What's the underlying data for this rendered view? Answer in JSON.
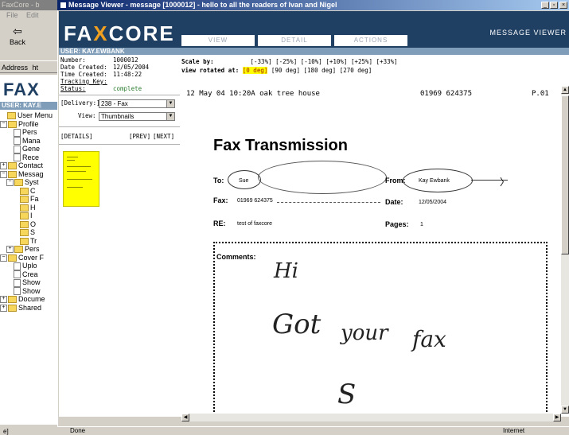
{
  "background_window": {
    "title": "FaxCore - b",
    "menu": [
      "File",
      "Edit"
    ],
    "back_label": "Back",
    "address_label": "Address",
    "address_value": "ht",
    "logo": "FAX",
    "user_label": "USER: KAY.E",
    "tree": [
      {
        "label": "User Menu",
        "icon": "folder-icon",
        "exp": ""
      },
      {
        "label": "Profile",
        "icon": "folder-icon",
        "exp": "−"
      },
      {
        "label": "Pers",
        "icon": "document-icon",
        "exp": ""
      },
      {
        "label": "Mana",
        "icon": "document-icon",
        "exp": ""
      },
      {
        "label": "Gene",
        "icon": "document-icon",
        "exp": ""
      },
      {
        "label": "Rece",
        "icon": "document-icon",
        "exp": ""
      },
      {
        "label": "Contact",
        "icon": "folder-icon",
        "exp": "+"
      },
      {
        "label": "Messag",
        "icon": "folder-icon",
        "exp": "−"
      },
      {
        "label": "Syst",
        "icon": "folder-icon",
        "exp": "−"
      },
      {
        "label": "C",
        "icon": "folder-icon",
        "exp": ""
      },
      {
        "label": "Fa",
        "icon": "folder-icon",
        "exp": ""
      },
      {
        "label": "H",
        "icon": "folder-icon",
        "exp": ""
      },
      {
        "label": "I",
        "icon": "folder-icon",
        "exp": ""
      },
      {
        "label": "O",
        "icon": "folder-icon",
        "exp": ""
      },
      {
        "label": "S",
        "icon": "folder-icon",
        "exp": ""
      },
      {
        "label": "Tr",
        "icon": "folder-icon",
        "exp": ""
      },
      {
        "label": "Pers",
        "icon": "folder-icon",
        "exp": "+"
      },
      {
        "label": "Cover F",
        "icon": "folder-icon",
        "exp": "−"
      },
      {
        "label": "Uplo",
        "icon": "document-icon",
        "exp": ""
      },
      {
        "label": "Crea",
        "icon": "document-icon",
        "exp": ""
      },
      {
        "label": "Show",
        "icon": "document-icon",
        "exp": ""
      },
      {
        "label": "Show",
        "icon": "document-icon",
        "exp": ""
      },
      {
        "label": "Docume",
        "icon": "folder-icon",
        "exp": "+"
      },
      {
        "label": "Shared",
        "icon": "folder-icon",
        "exp": "+"
      }
    ],
    "status": "e]"
  },
  "window": {
    "title": "Message Viewer - message [1000012] - hello to all the readers of Ivan and Nigel",
    "controls": {
      "minimize": "_",
      "restore": "▫",
      "close": "×"
    }
  },
  "header": {
    "logo_part1": "FA",
    "logo_x": "X",
    "logo_part2": "CORE",
    "tabs": [
      "VIEW",
      "DETAIL",
      "ACTIONS"
    ],
    "active_tab": "VIEW",
    "section_title": "MESSAGE VIEWER"
  },
  "user_bar": "USER: KAY.EWBANK",
  "message_meta": {
    "number_label": "Number:",
    "number": "1000012",
    "date_label": "Date Created:",
    "date": "12/05/2004",
    "time_label": "Time Created:",
    "time": "11:48:22",
    "tracking_label": "Tracking Key:",
    "tracking": "",
    "status_label": "Status:",
    "status": "complete"
  },
  "delivery": {
    "label": "[Delivery:]",
    "value": "238 - Fax"
  },
  "view": {
    "label": "View:",
    "value": "Thumbnails"
  },
  "nav": {
    "details": "[DETAILS]",
    "prev": "[PREV]",
    "next": "[NEXT]"
  },
  "scale": {
    "label": "Scale by:",
    "options": [
      "[-33%]",
      "[-25%]",
      "[-10%]",
      "[+10%]",
      "[+25%]",
      "[+33%]"
    ]
  },
  "rotation": {
    "label": "view rotated at:",
    "active": "[0 deg]",
    "options": [
      "[90 deg]",
      "[180 deg]",
      "[270 deg]"
    ]
  },
  "fax": {
    "header_date": "12 May 04 10:20A oak tree house",
    "header_phone": "01969 624375",
    "header_page": "P.01",
    "title": "Fax Transmission",
    "to_label": "To:",
    "to_value": "Sue",
    "from_label": "From:",
    "from_value": "Kay Ewbank",
    "fax_label": "Fax:",
    "fax_value": "01969 624375",
    "date_label": "Date:",
    "date_value": "12/05/2004",
    "re_label": "RE:",
    "re_value": "test of faxcore",
    "pages_label": "Pages:",
    "pages_value": "1",
    "comments_label": "Comments:",
    "handwriting": [
      "Hi",
      "Got",
      "your",
      "fax",
      "S"
    ]
  },
  "statusbar": {
    "done": "Done",
    "zone": "Internet"
  }
}
